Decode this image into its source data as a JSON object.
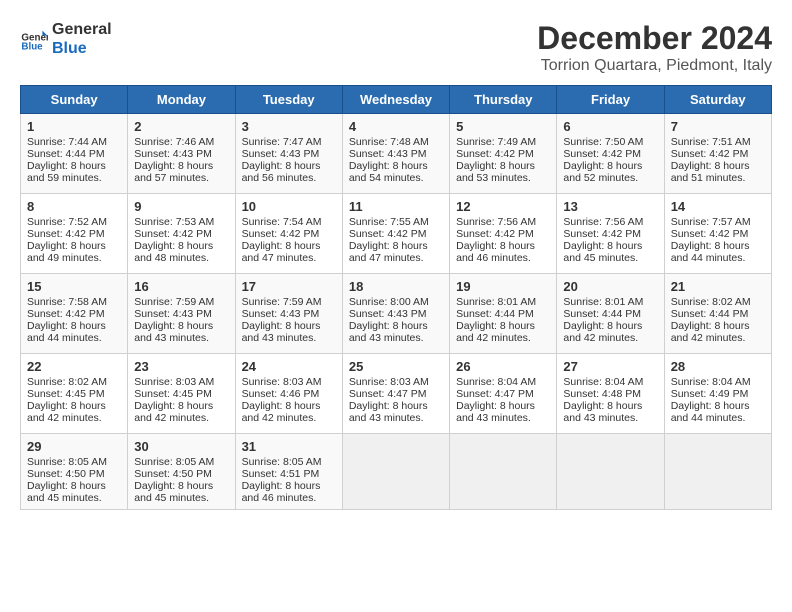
{
  "header": {
    "logo_line1": "General",
    "logo_line2": "Blue",
    "title": "December 2024",
    "subtitle": "Torrion Quartara, Piedmont, Italy"
  },
  "calendar": {
    "weekdays": [
      "Sunday",
      "Monday",
      "Tuesday",
      "Wednesday",
      "Thursday",
      "Friday",
      "Saturday"
    ],
    "weeks": [
      [
        {
          "day": "1",
          "sunrise": "Sunrise: 7:44 AM",
          "sunset": "Sunset: 4:44 PM",
          "daylight": "Daylight: 8 hours and 59 minutes."
        },
        {
          "day": "2",
          "sunrise": "Sunrise: 7:46 AM",
          "sunset": "Sunset: 4:43 PM",
          "daylight": "Daylight: 8 hours and 57 minutes."
        },
        {
          "day": "3",
          "sunrise": "Sunrise: 7:47 AM",
          "sunset": "Sunset: 4:43 PM",
          "daylight": "Daylight: 8 hours and 56 minutes."
        },
        {
          "day": "4",
          "sunrise": "Sunrise: 7:48 AM",
          "sunset": "Sunset: 4:43 PM",
          "daylight": "Daylight: 8 hours and 54 minutes."
        },
        {
          "day": "5",
          "sunrise": "Sunrise: 7:49 AM",
          "sunset": "Sunset: 4:42 PM",
          "daylight": "Daylight: 8 hours and 53 minutes."
        },
        {
          "day": "6",
          "sunrise": "Sunrise: 7:50 AM",
          "sunset": "Sunset: 4:42 PM",
          "daylight": "Daylight: 8 hours and 52 minutes."
        },
        {
          "day": "7",
          "sunrise": "Sunrise: 7:51 AM",
          "sunset": "Sunset: 4:42 PM",
          "daylight": "Daylight: 8 hours and 51 minutes."
        }
      ],
      [
        {
          "day": "8",
          "sunrise": "Sunrise: 7:52 AM",
          "sunset": "Sunset: 4:42 PM",
          "daylight": "Daylight: 8 hours and 49 minutes."
        },
        {
          "day": "9",
          "sunrise": "Sunrise: 7:53 AM",
          "sunset": "Sunset: 4:42 PM",
          "daylight": "Daylight: 8 hours and 48 minutes."
        },
        {
          "day": "10",
          "sunrise": "Sunrise: 7:54 AM",
          "sunset": "Sunset: 4:42 PM",
          "daylight": "Daylight: 8 hours and 47 minutes."
        },
        {
          "day": "11",
          "sunrise": "Sunrise: 7:55 AM",
          "sunset": "Sunset: 4:42 PM",
          "daylight": "Daylight: 8 hours and 47 minutes."
        },
        {
          "day": "12",
          "sunrise": "Sunrise: 7:56 AM",
          "sunset": "Sunset: 4:42 PM",
          "daylight": "Daylight: 8 hours and 46 minutes."
        },
        {
          "day": "13",
          "sunrise": "Sunrise: 7:56 AM",
          "sunset": "Sunset: 4:42 PM",
          "daylight": "Daylight: 8 hours and 45 minutes."
        },
        {
          "day": "14",
          "sunrise": "Sunrise: 7:57 AM",
          "sunset": "Sunset: 4:42 PM",
          "daylight": "Daylight: 8 hours and 44 minutes."
        }
      ],
      [
        {
          "day": "15",
          "sunrise": "Sunrise: 7:58 AM",
          "sunset": "Sunset: 4:42 PM",
          "daylight": "Daylight: 8 hours and 44 minutes."
        },
        {
          "day": "16",
          "sunrise": "Sunrise: 7:59 AM",
          "sunset": "Sunset: 4:43 PM",
          "daylight": "Daylight: 8 hours and 43 minutes."
        },
        {
          "day": "17",
          "sunrise": "Sunrise: 7:59 AM",
          "sunset": "Sunset: 4:43 PM",
          "daylight": "Daylight: 8 hours and 43 minutes."
        },
        {
          "day": "18",
          "sunrise": "Sunrise: 8:00 AM",
          "sunset": "Sunset: 4:43 PM",
          "daylight": "Daylight: 8 hours and 43 minutes."
        },
        {
          "day": "19",
          "sunrise": "Sunrise: 8:01 AM",
          "sunset": "Sunset: 4:44 PM",
          "daylight": "Daylight: 8 hours and 42 minutes."
        },
        {
          "day": "20",
          "sunrise": "Sunrise: 8:01 AM",
          "sunset": "Sunset: 4:44 PM",
          "daylight": "Daylight: 8 hours and 42 minutes."
        },
        {
          "day": "21",
          "sunrise": "Sunrise: 8:02 AM",
          "sunset": "Sunset: 4:44 PM",
          "daylight": "Daylight: 8 hours and 42 minutes."
        }
      ],
      [
        {
          "day": "22",
          "sunrise": "Sunrise: 8:02 AM",
          "sunset": "Sunset: 4:45 PM",
          "daylight": "Daylight: 8 hours and 42 minutes."
        },
        {
          "day": "23",
          "sunrise": "Sunrise: 8:03 AM",
          "sunset": "Sunset: 4:45 PM",
          "daylight": "Daylight: 8 hours and 42 minutes."
        },
        {
          "day": "24",
          "sunrise": "Sunrise: 8:03 AM",
          "sunset": "Sunset: 4:46 PM",
          "daylight": "Daylight: 8 hours and 42 minutes."
        },
        {
          "day": "25",
          "sunrise": "Sunrise: 8:03 AM",
          "sunset": "Sunset: 4:47 PM",
          "daylight": "Daylight: 8 hours and 43 minutes."
        },
        {
          "day": "26",
          "sunrise": "Sunrise: 8:04 AM",
          "sunset": "Sunset: 4:47 PM",
          "daylight": "Daylight: 8 hours and 43 minutes."
        },
        {
          "day": "27",
          "sunrise": "Sunrise: 8:04 AM",
          "sunset": "Sunset: 4:48 PM",
          "daylight": "Daylight: 8 hours and 43 minutes."
        },
        {
          "day": "28",
          "sunrise": "Sunrise: 8:04 AM",
          "sunset": "Sunset: 4:49 PM",
          "daylight": "Daylight: 8 hours and 44 minutes."
        }
      ],
      [
        {
          "day": "29",
          "sunrise": "Sunrise: 8:05 AM",
          "sunset": "Sunset: 4:50 PM",
          "daylight": "Daylight: 8 hours and 45 minutes."
        },
        {
          "day": "30",
          "sunrise": "Sunrise: 8:05 AM",
          "sunset": "Sunset: 4:50 PM",
          "daylight": "Daylight: 8 hours and 45 minutes."
        },
        {
          "day": "31",
          "sunrise": "Sunrise: 8:05 AM",
          "sunset": "Sunset: 4:51 PM",
          "daylight": "Daylight: 8 hours and 46 minutes."
        },
        null,
        null,
        null,
        null
      ]
    ]
  }
}
